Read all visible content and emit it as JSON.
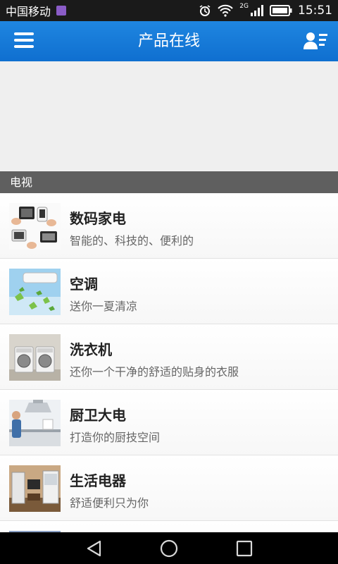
{
  "status_bar": {
    "carrier": "中国移动",
    "network": "2G",
    "time": "15:51"
  },
  "app_bar": {
    "title": "产品在线",
    "menu_icon": "hamburger-menu-icon",
    "user_icon": "user-list-icon"
  },
  "section": {
    "title": "电视"
  },
  "items": [
    {
      "title": "数码家电",
      "subtitle": "智能的、科技的、便利的"
    },
    {
      "title": "空调",
      "subtitle": "送你一夏清凉"
    },
    {
      "title": "洗衣机",
      "subtitle": "还你一个干净的舒适的贴身的衣服"
    },
    {
      "title": "厨卫大电",
      "subtitle": "打造你的厨技空间"
    },
    {
      "title": "生活电器",
      "subtitle": "舒适便利只为你"
    }
  ],
  "colors": {
    "app_bar": "#1a7fdc",
    "section_header": "#5f5f5f",
    "status_bar": "#1a1a1a"
  }
}
